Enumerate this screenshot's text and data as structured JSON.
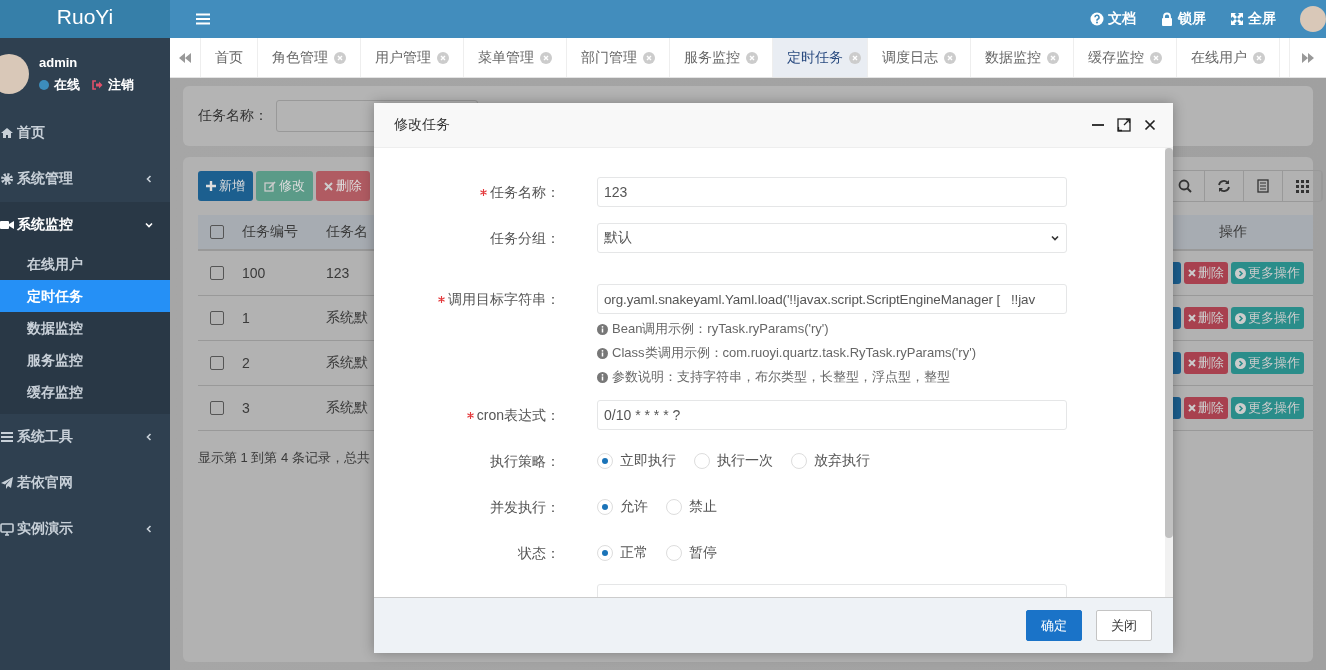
{
  "header": {
    "logo": "RuoYi",
    "links": [
      {
        "label": "文档"
      },
      {
        "label": "锁屏"
      },
      {
        "label": "全屏"
      }
    ]
  },
  "sidebar": {
    "user": {
      "name": "admin",
      "status": "在线",
      "logout": "注销"
    },
    "items": [
      {
        "kind": "link",
        "label": "首页"
      },
      {
        "kind": "group",
        "label": "系统管理",
        "expanded": false
      },
      {
        "kind": "group",
        "label": "系统监控",
        "expanded": true,
        "children": [
          {
            "label": "在线用户",
            "selected": false
          },
          {
            "label": "定时任务",
            "selected": true
          },
          {
            "label": "数据监控",
            "selected": false
          },
          {
            "label": "服务监控",
            "selected": false
          },
          {
            "label": "缓存监控",
            "selected": false
          }
        ]
      },
      {
        "kind": "group",
        "label": "系统工具",
        "expanded": false
      },
      {
        "kind": "link",
        "label": "若依官网"
      },
      {
        "kind": "group",
        "label": "实例演示",
        "expanded": false
      }
    ]
  },
  "tabs": [
    {
      "label": "首页",
      "selected": false,
      "closable": false
    },
    {
      "label": "角色管理",
      "selected": false,
      "closable": true
    },
    {
      "label": "用户管理",
      "selected": false,
      "closable": true
    },
    {
      "label": "菜单管理",
      "selected": false,
      "closable": true
    },
    {
      "label": "部门管理",
      "selected": false,
      "closable": true
    },
    {
      "label": "服务监控",
      "selected": false,
      "closable": true
    },
    {
      "label": "定时任务",
      "selected": true,
      "closable": true
    },
    {
      "label": "调度日志",
      "selected": false,
      "closable": true
    },
    {
      "label": "数据监控",
      "selected": false,
      "closable": true
    },
    {
      "label": "缓存监控",
      "selected": false,
      "closable": true
    },
    {
      "label": "在线用户",
      "selected": false,
      "closable": true
    }
  ],
  "search": {
    "label": "任务名称："
  },
  "toolbar": [
    {
      "kind": "add",
      "label": "新增"
    },
    {
      "kind": "edit",
      "label": "修改"
    },
    {
      "kind": "delete",
      "label": "删除"
    }
  ],
  "table": {
    "header_checked": false,
    "columns": [
      "任务编号",
      "任务名"
    ],
    "action_column": "操作",
    "rows": [
      {
        "checked": false,
        "cells": [
          "100",
          "123"
        ],
        "actions": [
          "删除",
          "更多操作"
        ]
      },
      {
        "checked": false,
        "cells": [
          "1",
          "系统默"
        ],
        "actions": [
          "删除",
          "更多操作"
        ]
      },
      {
        "checked": false,
        "cells": [
          "2",
          "系统默"
        ],
        "actions": [
          "删除",
          "更多操作"
        ]
      },
      {
        "checked": false,
        "cells": [
          "3",
          "系统默"
        ],
        "actions": [
          "删除",
          "更多操作"
        ]
      }
    ],
    "footer": "显示第 1 到第 4 条记录，总共"
  },
  "dialog": {
    "title": "修改任务",
    "fields": [
      {
        "kind": "text",
        "label": "任务名称：",
        "required": true,
        "value": "123"
      },
      {
        "kind": "select",
        "label": "任务分组：",
        "required": false,
        "value": "默认"
      },
      {
        "kind": "text",
        "label": "调用目标字符串：",
        "required": true,
        "value": "org.yaml.snakeyaml.Yaml.load('!!javax.script.ScriptEngineManager [   !!jav",
        "hints": [
          "Bean调用示例：ryTask.ryParams('ry')",
          "Class类调用示例：com.ruoyi.quartz.task.RyTask.ryParams('ry')",
          "参数说明：支持字符串，布尔类型，长整型，浮点型，整型"
        ]
      },
      {
        "kind": "text",
        "label": "cron表达式：",
        "required": true,
        "value": "0/10 * * * * ?"
      },
      {
        "kind": "radio",
        "label": "执行策略：",
        "required": false,
        "options": [
          {
            "label": "立即执行",
            "selected": true
          },
          {
            "label": "执行一次",
            "selected": false
          },
          {
            "label": "放弃执行",
            "selected": false
          }
        ]
      },
      {
        "kind": "radio",
        "label": "并发执行：",
        "required": false,
        "options": [
          {
            "label": "允许",
            "selected": true
          },
          {
            "label": "禁止",
            "selected": false
          }
        ]
      },
      {
        "kind": "radio",
        "label": "状态：",
        "required": false,
        "options": [
          {
            "label": "正常",
            "selected": true
          },
          {
            "label": "暂停",
            "selected": false
          }
        ]
      },
      {
        "kind": "textarea"
      }
    ],
    "buttons": [
      {
        "kind": "primary",
        "label": "确定"
      },
      {
        "kind": "default",
        "label": "关闭"
      }
    ]
  }
}
